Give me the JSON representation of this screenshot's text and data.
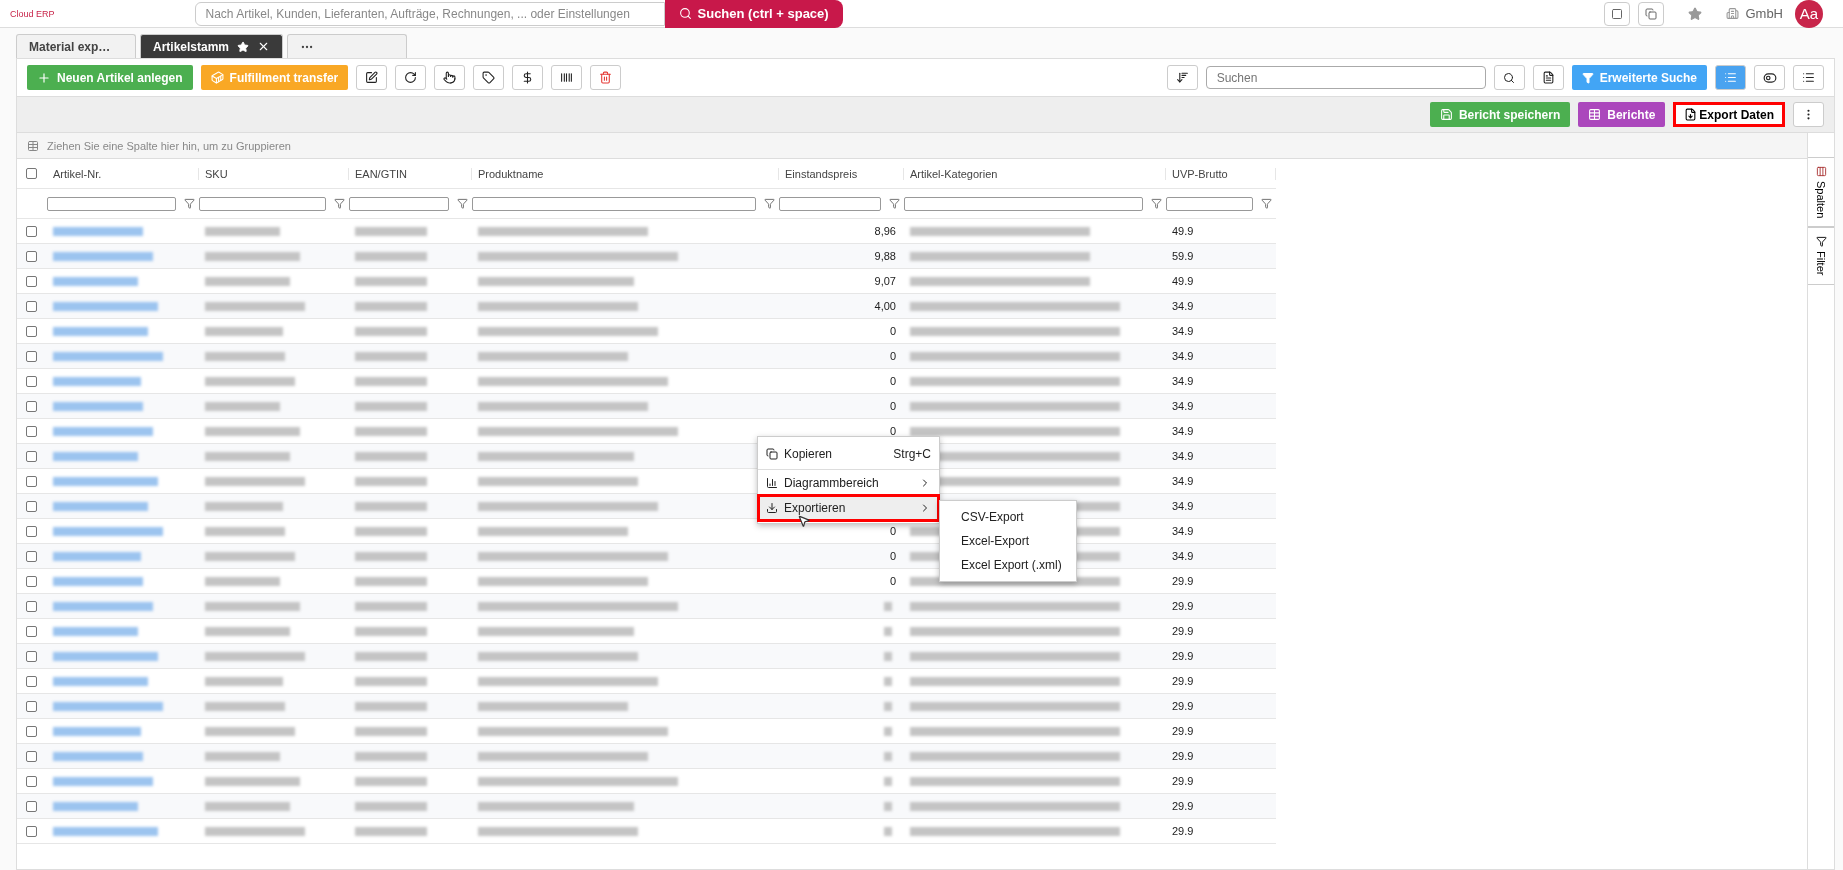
{
  "header": {
    "logo_tagline": "Cloud ERP",
    "search": {
      "placeholder": "Nach Artikel, Kunden, Lieferanten, Aufträge, Rechnungen, ... oder Einstellungen"
    },
    "search_button": "Suchen (ctrl + space)",
    "company": "GmbH",
    "avatar": "Aa"
  },
  "tabs": [
    {
      "label": "Material exp…",
      "selected": false,
      "closable": false
    },
    {
      "label": "Artikelstamm",
      "selected": true,
      "closable": true
    }
  ],
  "toolbar": {
    "new_button": "Neuen Artikel anlegen",
    "fulfillment_button": "Fulfillment transfer",
    "search": {
      "placeholder": "Suchen"
    },
    "advanced_search": "Erweiterte Suche",
    "filter_active": true
  },
  "report_bar": {
    "save_button": "Bericht speichern",
    "reports_button": "Berichte",
    "export_button": {
      "label": "Export Daten",
      "highlighted": true
    }
  },
  "group_panel": "Ziehen Sie eine Spalte hier hin, um zu Gruppieren",
  "table": {
    "all_checked": false,
    "columns": [
      "Artikel-Nr.",
      "SKU",
      "EAN/GTIN",
      "Produktname",
      "Einstandspreis",
      "Artikel-Kategorien",
      "UVP-Brutto"
    ],
    "rows": [
      {
        "checked": false,
        "einstandspreis": "8,96",
        "uvp": "49.9"
      },
      {
        "checked": false,
        "einstandspreis": "9,88",
        "uvp": "59.9"
      },
      {
        "checked": false,
        "einstandspreis": "9,07",
        "uvp": "49.9"
      },
      {
        "checked": false,
        "einstandspreis": "4,00",
        "uvp": "34.9"
      },
      {
        "checked": false,
        "einstandspreis": "0",
        "uvp": "34.9"
      },
      {
        "checked": false,
        "einstandspreis": "0",
        "uvp": "34.9"
      },
      {
        "checked": false,
        "einstandspreis": "0",
        "uvp": "34.9"
      },
      {
        "checked": false,
        "einstandspreis": "0",
        "uvp": "34.9"
      },
      {
        "checked": false,
        "einstandspreis": "0",
        "uvp": "34.9"
      },
      {
        "checked": false,
        "uvp": "34.9"
      },
      {
        "checked": false,
        "uvp": "34.9"
      },
      {
        "checked": false,
        "uvp": "34.9"
      },
      {
        "checked": false,
        "einstandspreis": "0",
        "uvp": "34.9"
      },
      {
        "checked": false,
        "einstandspreis": "0",
        "uvp": "34.9"
      },
      {
        "checked": false,
        "einstandspreis": "0",
        "uvp": "29.9"
      },
      {
        "checked": false,
        "uvp": "29.9"
      },
      {
        "checked": false,
        "uvp": "29.9"
      },
      {
        "checked": false,
        "uvp": "29.9"
      },
      {
        "checked": false,
        "uvp": "29.9"
      },
      {
        "checked": false,
        "uvp": "29.9"
      },
      {
        "checked": false,
        "uvp": "29.9"
      },
      {
        "checked": false,
        "uvp": "29.9"
      },
      {
        "checked": false,
        "uvp": "29.9"
      },
      {
        "checked": false,
        "uvp": "29.9"
      },
      {
        "checked": false,
        "uvp": "29.9"
      }
    ]
  },
  "side_panel": [
    "Spalten",
    "Filter"
  ],
  "context_menu": {
    "items": [
      {
        "label": "Kopieren",
        "shortcut": "Strg+C",
        "kind": "action",
        "highlighted": false
      },
      {
        "label": "Diagrammbereich",
        "kind": "submenu",
        "highlighted": false
      },
      {
        "label": "Exportieren",
        "kind": "submenu",
        "highlighted": true
      }
    ],
    "submenu": [
      "CSV-Export",
      "Excel-Export",
      "Excel Export (.xml)"
    ]
  }
}
